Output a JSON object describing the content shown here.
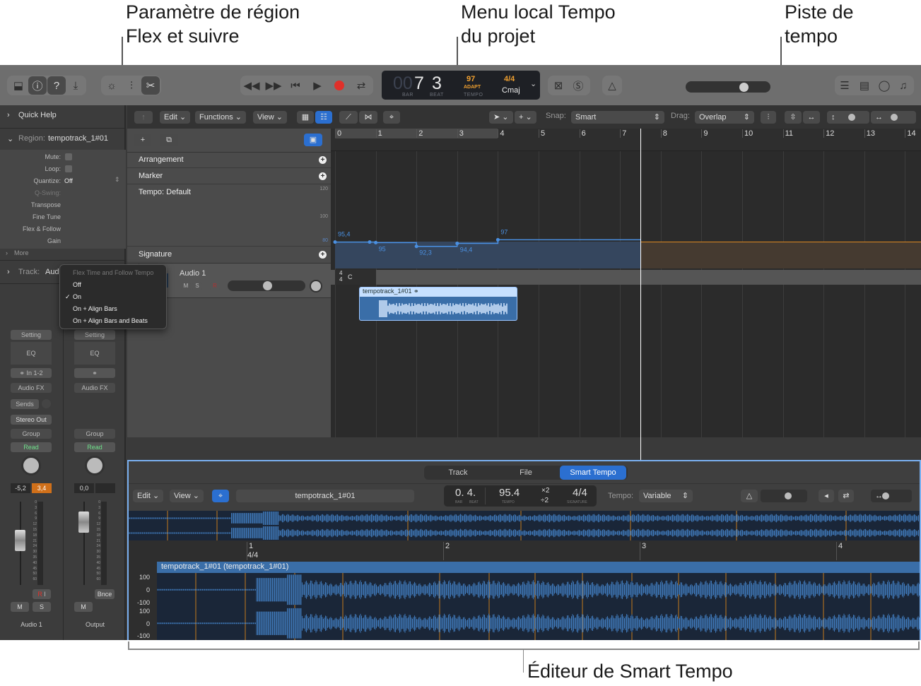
{
  "callouts": {
    "flex_param": [
      "Paramètre de région",
      "Flex et suivre"
    ],
    "tempo_menu": [
      "Menu local Tempo",
      "du projet"
    ],
    "tempo_track": [
      "Piste de",
      "tempo"
    ],
    "smart_tempo_editor": "Éditeur de Smart Tempo"
  },
  "control_bar": {
    "left_icons": [
      "library-icon",
      "inspector-icon",
      "quick-help-icon",
      "download-icon"
    ],
    "mid_icons": [
      "smart-controls-icon",
      "mixer-icon",
      "editors-scissors-icon"
    ],
    "transport": [
      "rewind-icon",
      "fast-forward-icon",
      "go-to-start-icon",
      "play-icon",
      "record-icon",
      "cycle-icon"
    ],
    "lcd": {
      "bar_dim": "00",
      "bar": "7",
      "beat": "3",
      "bar_label": "BAR",
      "beat_label": "BEAT",
      "tempo": "97",
      "tempo_mode": "ADAPT",
      "tempo_label": "TEMPO",
      "signature": "4/4",
      "key": "Cmaj"
    },
    "master_volume": 0.72,
    "right_icons": [
      "list-editors-icon",
      "note-pad-icon",
      "loop-browser-icon",
      "browsers-icon"
    ]
  },
  "inspector": {
    "quick_help": "Quick Help",
    "region_label": "Region:",
    "region_name": "tempotrack_1#01",
    "params": [
      {
        "label": "Mute:",
        "value": ""
      },
      {
        "label": "Loop:",
        "value": ""
      },
      {
        "label": "Quantize:",
        "value": "Off"
      },
      {
        "label": "Q-Swing:",
        "value": ""
      },
      {
        "label": "Transpose",
        "value": ""
      },
      {
        "label": "Fine Tune",
        "value": ""
      },
      {
        "label": "Flex & Follow",
        "value": ""
      },
      {
        "label": "Gain",
        "value": ""
      }
    ],
    "more": "More",
    "track_label": "Track:",
    "track_name": "Audio 1",
    "flex_menu": {
      "title": "Flex Time and Follow Tempo",
      "items": [
        "Off",
        "On",
        "On + Align Bars",
        "On + Align Bars and Beats"
      ],
      "selected": "On"
    },
    "strips": [
      {
        "setting": "Setting",
        "eq": "EQ",
        "input": "In 1-2",
        "audio_fx": "Audio FX",
        "sends": "Sends",
        "output": "Stereo Out",
        "group": "Group",
        "automation": "Read",
        "vol": "-5,2",
        "peak": "3,4",
        "rec": "R",
        "input_mon": "I",
        "mute": "M",
        "solo": "S",
        "name": "Audio 1"
      },
      {
        "setting": "Setting",
        "eq": "EQ",
        "input": "",
        "audio_fx": "Audio FX",
        "group": "Group",
        "automation": "Read",
        "vol": "0,0",
        "peak": "",
        "bounce": "Bnce",
        "mute": "M",
        "name": "Output"
      }
    ],
    "meter_scale": [
      "0",
      "3",
      "6",
      "9",
      "12",
      "15",
      "18",
      "21",
      "24",
      "30",
      "35",
      "40",
      "45",
      "50",
      "60"
    ]
  },
  "tracks_toolbar": {
    "edit": "Edit",
    "functions": "Functions",
    "view": "View",
    "snap_label": "Snap:",
    "snap_value": "Smart",
    "drag_label": "Drag:",
    "drag_value": "Overlap"
  },
  "global_tracks": {
    "arrangement": "Arrangement",
    "marker": "Marker",
    "tempo": "Tempo: Default",
    "signature": "Signature",
    "tempo_scale": [
      "120",
      "100",
      "80"
    ],
    "sig_value_top": "4",
    "sig_value_bottom": "4",
    "key_value": "C"
  },
  "ruler_bars": [
    "0",
    "1",
    "2",
    "3",
    "4",
    "5",
    "6",
    "7",
    "8",
    "9",
    "10",
    "11",
    "12",
    "13",
    "14"
  ],
  "tempo_points": [
    {
      "bar": 0.0,
      "bpm": 95.4,
      "label": "95,4"
    },
    {
      "bar": 0.85,
      "bpm": 95.4,
      "label": ""
    },
    {
      "bar": 1.0,
      "bpm": 95,
      "label": "95"
    },
    {
      "bar": 2.0,
      "bpm": 92.3,
      "label": "92,3"
    },
    {
      "bar": 3.0,
      "bpm": 94.4,
      "label": "94,4"
    },
    {
      "bar": 4.0,
      "bpm": 97,
      "label": "97"
    }
  ],
  "track": {
    "number": "1",
    "name": "Audio 1",
    "mute": "M",
    "solo": "S",
    "rec": "R",
    "region_name": "tempotrack_1#01"
  },
  "smart_tempo": {
    "tabs": [
      "Track",
      "File",
      "Smart Tempo"
    ],
    "active_tab": "Smart Tempo",
    "edit": "Edit",
    "view": "View",
    "region_name": "tempotrack_1#01",
    "position": "0. 4.",
    "pos_labels": [
      "BAR",
      "BEAT"
    ],
    "tempo": "95.4",
    "tempo_label": "TEMPO",
    "x2": "×2",
    "div2": "÷2",
    "signature": "4/4",
    "signature_label": "SIGNATURE",
    "tempo_mode_label": "Tempo:",
    "tempo_mode": "Variable",
    "bars": [
      "1",
      "2",
      "3",
      "4"
    ],
    "bar1_sig": "4/4",
    "region_title": "tempotrack_1#01 (tempotrack_1#01)",
    "y_labels": [
      "100",
      "0",
      "-100",
      "100",
      "0",
      "-100"
    ]
  },
  "colors": {
    "accent_blue": "#2b6fd0",
    "tempo_orange": "#f0a030",
    "record_red": "#e0302a",
    "read_green": "#6fe08a",
    "region_blue": "#3a6ea8"
  }
}
